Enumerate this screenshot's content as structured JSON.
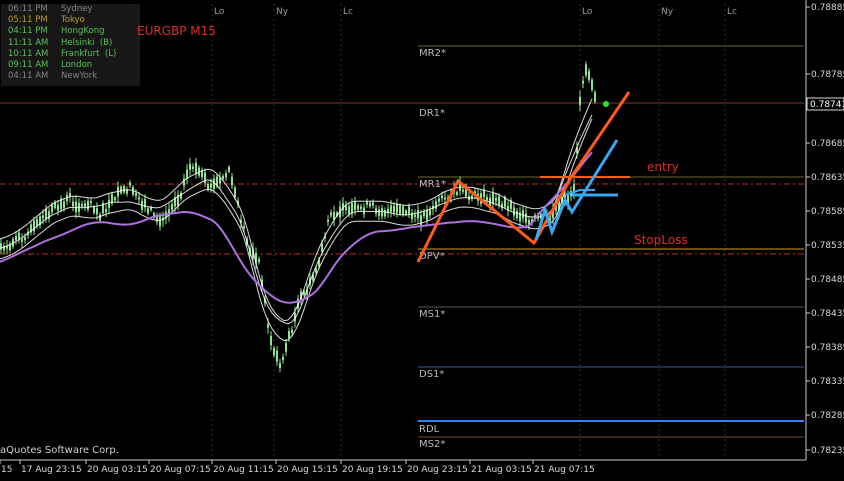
{
  "symbol_label": "EURGBP M15",
  "colors": {
    "background": "#000000",
    "candle": "#8fe58f",
    "bb_band": "#ffffff",
    "ma": "#b070e0",
    "pivot_olive": "#6b6b2a",
    "pivot_dashed": "#c03020",
    "rdl": "#2f7fff",
    "zigzag_orange": "#ff5a1a",
    "zigzag_blue": "#3aa8f0",
    "text_red": "#e02a2a",
    "axis": "#c8c8c8",
    "price_current_bg": "#000000",
    "sessions_dim": "#909090",
    "sessions_active": "#c7a53a",
    "sessions_green": "#5fd15f"
  },
  "sessions": [
    {
      "time": "06:11 PM",
      "name": "Sydney",
      "state": "dim"
    },
    {
      "time": "05:11 PM",
      "name": "Tokyo",
      "state": "active"
    },
    {
      "time": "04:11 PM",
      "name": "HongKong",
      "state": "green"
    },
    {
      "time": "11:11 AM",
      "name": "Helsinki  (B)",
      "state": "green"
    },
    {
      "time": "10:11 AM",
      "name": "Frankfurt  (L)",
      "state": "green"
    },
    {
      "time": "09:11 AM",
      "name": "London",
      "state": "green"
    },
    {
      "time": "04:11 AM",
      "name": "NewYork",
      "state": "dim"
    }
  ],
  "session_markers": [
    "Lo",
    "Ny",
    "Lc",
    "Lo",
    "Ny",
    "Lc"
  ],
  "pivot_labels": [
    "MR2*",
    "DR1*",
    "MR1*",
    "DPV*",
    "MS1*",
    "DS1*",
    "RDL",
    "MS2*"
  ],
  "annotations": {
    "entry": "entry",
    "stoploss": "StopLoss"
  },
  "copyright": "aQuotes Software Corp.",
  "chart_data": {
    "type": "line",
    "title": "EURGBP M15",
    "y_ticks": [
      "0.78885",
      "0.78785",
      "0.78685",
      "0.78635",
      "0.78585",
      "0.78535",
      "0.78485",
      "0.78435",
      "0.78385",
      "0.78335",
      "0.78285",
      "0.78235"
    ],
    "current_price": "0.78741",
    "x_ticks": [
      "15",
      "17 Aug 23:15",
      "20 Aug 03:15",
      "20 Aug 07:15",
      "20 Aug 11:15",
      "20 Aug 15:15",
      "20 Aug 19:15",
      "20 Aug 23:15",
      "21 Aug 03:15",
      "21 Aug 07:15"
    ]
  }
}
